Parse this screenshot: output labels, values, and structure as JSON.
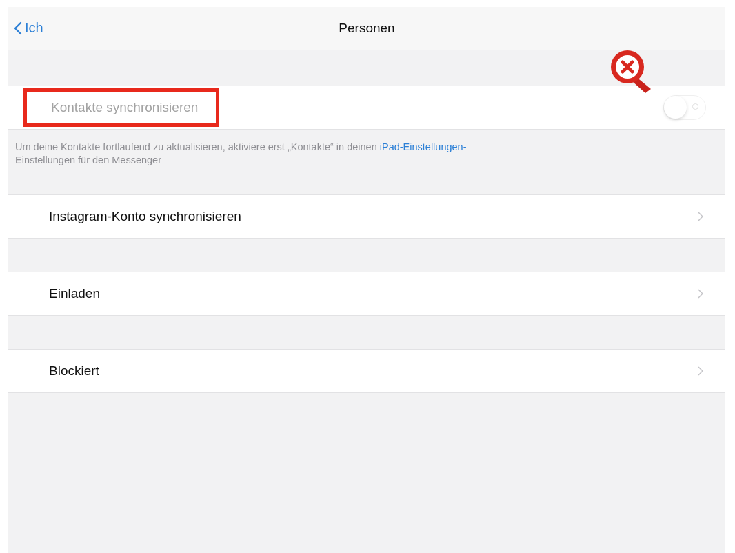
{
  "nav": {
    "back": "Ich",
    "title": "Personen"
  },
  "sync_row": {
    "label": "Kontakte synchronisieren",
    "on": false,
    "disabled": true,
    "highlighted": true,
    "error_marker": true
  },
  "sync_footer": {
    "text": "Um deine Kontakte fortlaufend zu aktualisieren, aktiviere erst „Kontakte“ in deinen ",
    "link": "iPad-Einstellungen-",
    "text_after": "Einstellungen für den Messenger"
  },
  "items": [
    {
      "label": "Instagram-Konto synchronisieren"
    },
    {
      "label": "Einladen"
    },
    {
      "label": "Blockiert"
    }
  ]
}
